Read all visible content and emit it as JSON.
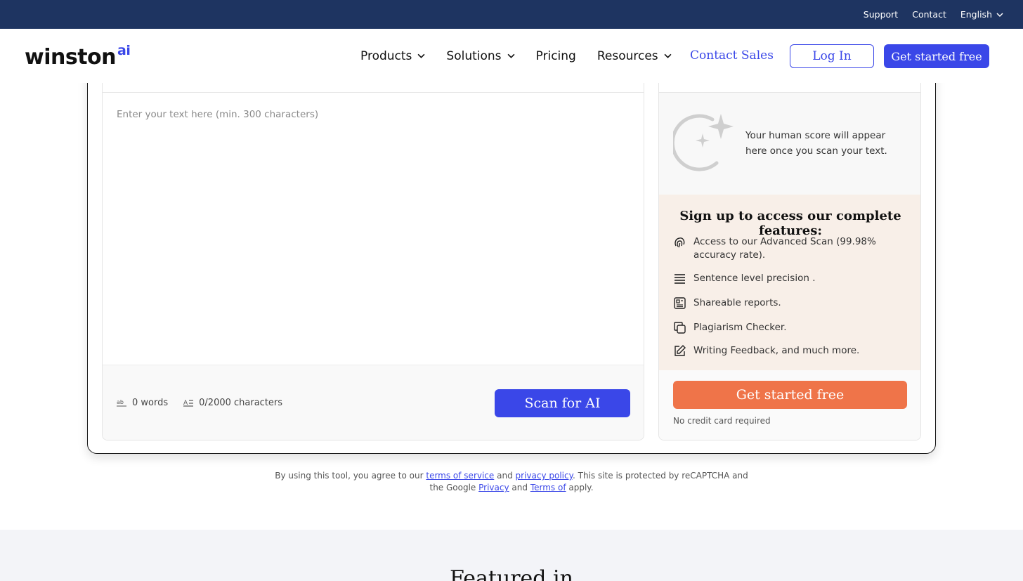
{
  "topbar": {
    "support": "Support",
    "contact": "Contact",
    "language": "English"
  },
  "nav": {
    "logo_main": "winston",
    "logo_suffix": "ai",
    "products": "Products",
    "solutions": "Solutions",
    "pricing": "Pricing",
    "resources": "Resources",
    "contact_sales": "Contact Sales",
    "login": "Log In",
    "get_started": "Get started free"
  },
  "editor": {
    "placeholder": "Enter your text here (min. 300 characters)",
    "words": "0 words",
    "characters": "0/2000  characters",
    "scan_button": "Scan for AI"
  },
  "sidebar": {
    "score_text": "Your human score will appear here once you scan your text.",
    "features_title": "Sign up to access our complete features:",
    "features": [
      {
        "icon": "fingerprint-icon",
        "label": "Access to our Advanced Scan (99.98% accuracy rate)."
      },
      {
        "icon": "lines-icon",
        "label": "Sentence level precision ."
      },
      {
        "icon": "report-icon",
        "label": "Shareable reports."
      },
      {
        "icon": "copy-icon",
        "label": "Plagiarism Checker."
      },
      {
        "icon": "pencil-icon",
        "label": "Writing Feedback, and much more."
      }
    ],
    "cta_button": "Get started free",
    "no_credit_card": "No credit card required"
  },
  "legal": {
    "prefix": "By using this tool, you agree to our",
    "terms_of_service": "terms of service",
    "and1": "and",
    "privacy_policy": "privacy policy",
    "middle": ". This site is protected by reCAPTCHA and",
    "line2_prefix": "the Google",
    "privacy": "Privacy",
    "and2": "and",
    "terms_of": "Terms of",
    "suffix": "apply."
  },
  "featured": {
    "title": "Featured in"
  },
  "colors": {
    "navy": "#1e3461",
    "accent": "#3a47e8",
    "orange": "#ef7449",
    "features_bg": "#f8efe8"
  }
}
